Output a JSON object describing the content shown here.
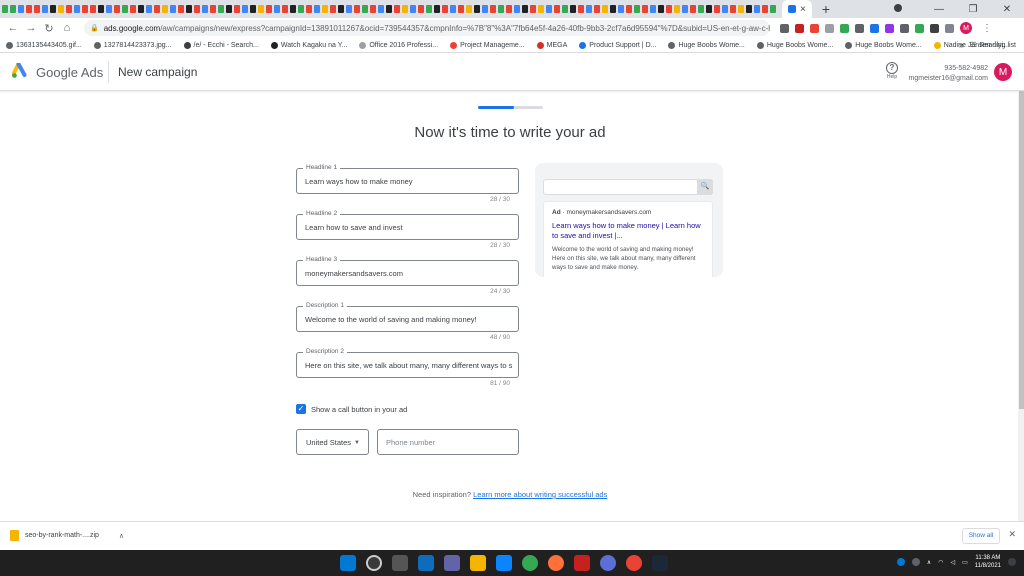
{
  "browser": {
    "tab_close": "×",
    "new_tab": "+",
    "url_host": "ads.google.com",
    "url_path": "/aw/campaigns/new/express?campaignId=13891011267&ocid=739544357&cmpnInfo=%7B\"8\"%3A\"7fb64e5f-4a26-40fb-9bb3-2cf7a6d95594\"%7D&subid=US-en-et-g-aw-c-home...",
    "profile_initial": "M",
    "bookmarks": [
      "1363135443405.gif...",
      "1327814423373.jpg...",
      "/e/ - Ecchi - Search...",
      "Watch Kagaku na Y...",
      "Office 2016 Professi...",
      "Project Manageme...",
      "MEGA",
      "Product Support | D...",
      "Huge Boobs Wome...",
      "Huge Boobs Wome...",
      "Huge Boobs Wome...",
      "Nadine Jansen - lyi..."
    ],
    "bookmarks_more": "»",
    "reading_list": "Reading list"
  },
  "header": {
    "brand": "Google Ads",
    "page_name": "New campaign",
    "help_label": "Help",
    "account_phone": "935-582-4982",
    "account_email": "mgmeister16@gmail.com",
    "avatar_initial": "M"
  },
  "progress": {
    "fraction": 0.55
  },
  "main": {
    "heading": "Now it's time to write your ad",
    "fields": [
      {
        "label": "Headline 1",
        "value": "Learn ways how to make money",
        "counter": "28 / 30"
      },
      {
        "label": "Headline 2",
        "value": "Learn how to save and invest",
        "counter": "28 / 30"
      },
      {
        "label": "Headline 3",
        "value": "moneymakersandsavers.com",
        "counter": "24 / 30"
      },
      {
        "label": "Description 1",
        "value": "Welcome to the world of saving and making money!",
        "counter": "48 / 90"
      },
      {
        "label": "Description 2",
        "value": "Here on this site, we talk about many, many different ways to s",
        "counter": "81 / 90"
      }
    ],
    "call_button_label": "Show a call button in your ad",
    "country": "United States",
    "phone_placeholder": "Phone number",
    "inspiration_prefix": "Need inspiration?",
    "inspiration_link": "Learn more about writing successful ads"
  },
  "preview": {
    "ad_badge": "Ad",
    "url": "· moneymakersandsavers.com",
    "title": "Learn ways how to make money | Learn how to save and invest |...",
    "description": "Welcome to the world of saving and making money! Here on this site, we talk about many, many different ways to save and make money."
  },
  "download": {
    "filename": "seo-by-rank-math-....zip",
    "show_all": "Show all"
  },
  "taskbar": {
    "time": "11:38 AM",
    "date": "11/8/2021"
  },
  "colors": {
    "accent": "#1a73e8",
    "avatar": "#d81b60",
    "ad_title": "#1a0dab"
  }
}
